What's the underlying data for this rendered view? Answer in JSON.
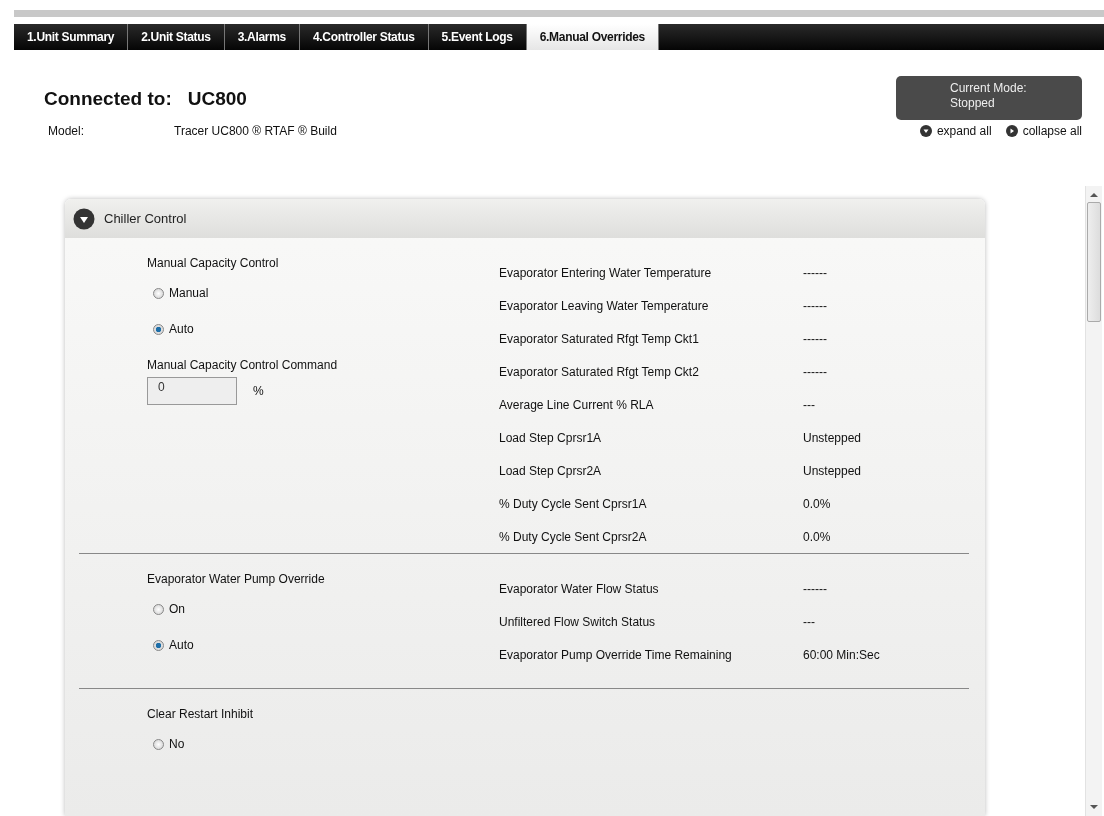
{
  "tabs": [
    {
      "label": "1.Unit Summary",
      "selected": false
    },
    {
      "label": "2.Unit Status",
      "selected": false
    },
    {
      "label": "3.Alarms",
      "selected": false
    },
    {
      "label": "4.Controller Status",
      "selected": false
    },
    {
      "label": "5.Event Logs",
      "selected": false
    },
    {
      "label": "6.Manual Overrides",
      "selected": true
    }
  ],
  "header": {
    "connected_label": "Connected to:",
    "connected_value": "UC800",
    "mode_label": "Current Mode:",
    "mode_value": "Stopped",
    "model_label": "Model:",
    "model_value": "Tracer UC800 ® RTAF ® Build",
    "expand_all": "expand all",
    "collapse_all": "collapse all"
  },
  "panel": {
    "title": "Chiller Control",
    "expanded": true,
    "sections": [
      {
        "title": "Manual Capacity Control",
        "options": [
          {
            "label": "Manual",
            "selected": false
          },
          {
            "label": "Auto",
            "selected": true
          }
        ],
        "command": {
          "label": "Manual Capacity Control Command",
          "value": "0",
          "unit": "%"
        },
        "readings": [
          {
            "name": "Evaporator Entering Water Temperature",
            "value": "------"
          },
          {
            "name": "Evaporator Leaving Water Temperature",
            "value": "------"
          },
          {
            "name": "Evaporator Saturated Rfgt Temp Ckt1",
            "value": "------"
          },
          {
            "name": "Evaporator Saturated Rfgt Temp Ckt2",
            "value": "------"
          },
          {
            "name": "Average Line Current % RLA",
            "value": "---"
          },
          {
            "name": "Load Step Cprsr1A",
            "value": "Unstepped"
          },
          {
            "name": "Load Step Cprsr2A",
            "value": "Unstepped"
          },
          {
            "name": "% Duty Cycle Sent Cprsr1A",
            "value": "0.0%"
          },
          {
            "name": "% Duty Cycle Sent Cprsr2A",
            "value": "0.0%"
          }
        ]
      },
      {
        "title": "Evaporator Water Pump Override",
        "options": [
          {
            "label": "On",
            "selected": false
          },
          {
            "label": "Auto",
            "selected": true
          }
        ],
        "readings": [
          {
            "name": "Evaporator Water Flow Status",
            "value": "------"
          },
          {
            "name": "Unfiltered Flow Switch Status",
            "value": "---"
          },
          {
            "name": "Evaporator Pump Override Time Remaining",
            "value": "60:00 Min:Sec"
          }
        ]
      },
      {
        "title": "Clear Restart Inhibit",
        "options": [
          {
            "label": "No",
            "selected": false
          }
        ]
      }
    ]
  }
}
